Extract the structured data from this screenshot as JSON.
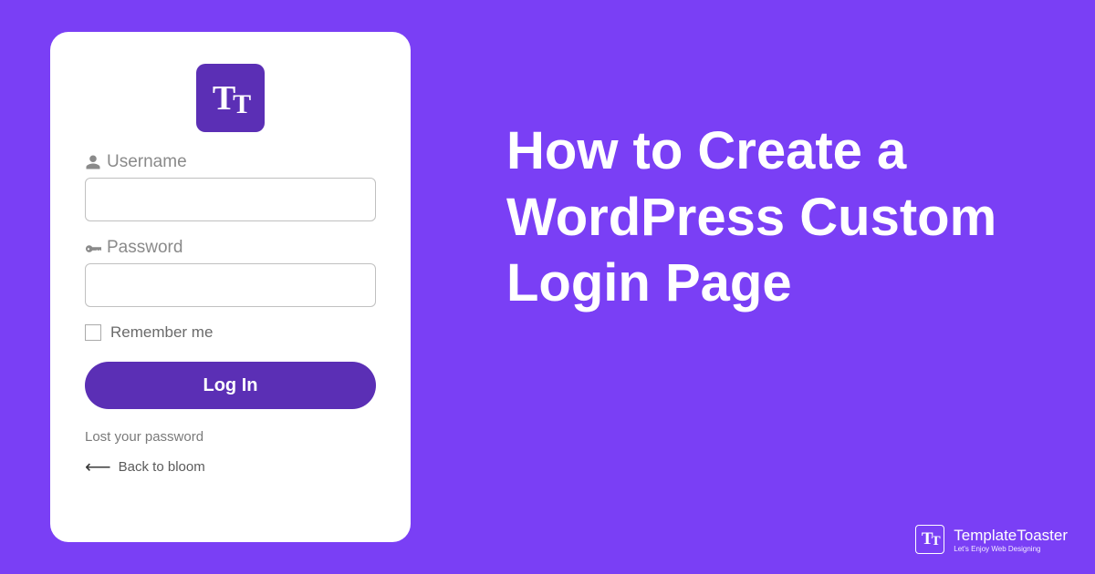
{
  "login": {
    "logo_text": "TT",
    "username_label": "Username",
    "password_label": "Password",
    "remember_label": "Remember me",
    "submit_label": "Log In",
    "forgot_link": "Lost your password",
    "back_link": "Back to bloom"
  },
  "headline": "How to Create a WordPress Custom Login Page",
  "brand": {
    "icon_text": "TT",
    "name": "TemplateToaster",
    "tagline": "Let's Enjoy Web Designing"
  }
}
